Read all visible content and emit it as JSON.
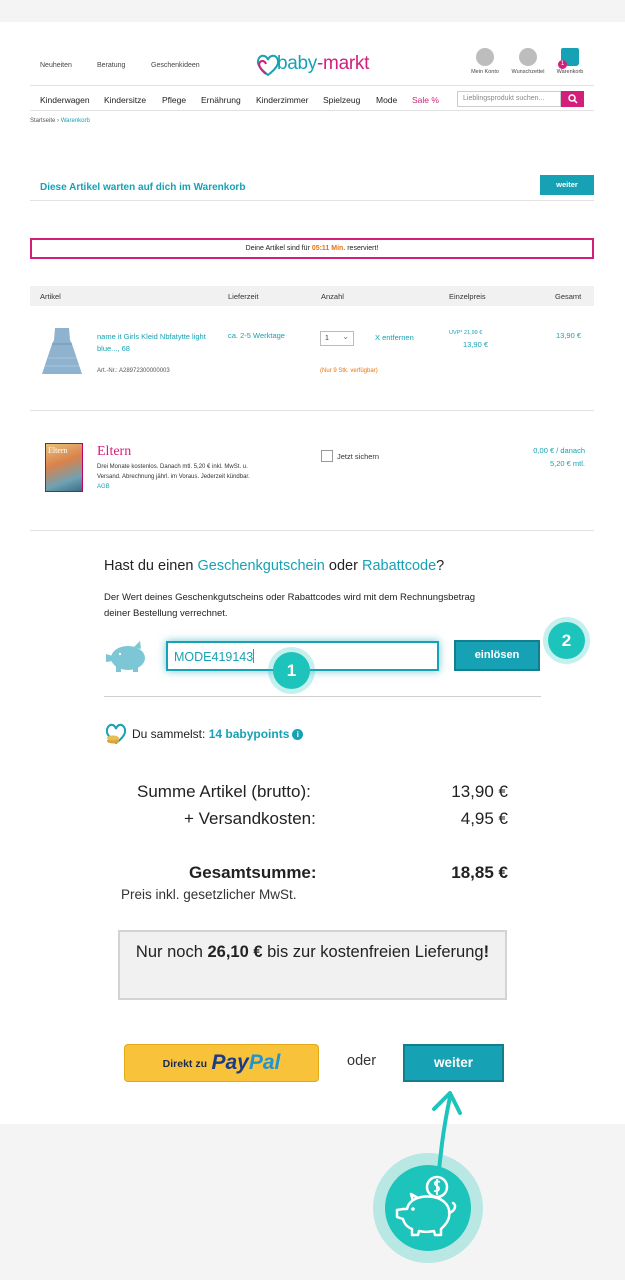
{
  "header": {
    "top_links": [
      "Neuheiten",
      "Beratung",
      "Geschenkideen"
    ],
    "logo": {
      "part1": "baby",
      "part2": "-markt"
    },
    "icons": [
      {
        "label": "Mein Konto",
        "icon": "user-icon"
      },
      {
        "label": "Wunschzettel",
        "icon": "heart-icon"
      },
      {
        "label": "Warenkorb",
        "icon": "shopping-bag-icon",
        "badge": "1"
      }
    ],
    "categories": [
      "Kinderwagen",
      "Kindersitze",
      "Pflege",
      "Ernährung",
      "Kinderzimmer",
      "Spielzeug",
      "Mode",
      "Sale %"
    ],
    "search_placeholder": "Lieblingsprodukt suchen..."
  },
  "breadcrumb": {
    "home": "Startseite",
    "sep": "›",
    "current": "Warenkorb"
  },
  "cart_header": {
    "title": "Diese Artikel warten auf dich im Warenkorb",
    "button": "weiter"
  },
  "reservation": {
    "before": "Deine Artikel sind für ",
    "time": "05:11 Min.",
    "after": " reserviert!"
  },
  "table": {
    "columns": [
      "Artikel",
      "Lieferzeit",
      "Anzahl",
      "Einzelpreis",
      "Gesamt"
    ]
  },
  "item": {
    "name": "name it Girls Kleid Nbfatytte light blue..., 68",
    "art_nr": "Art.-Nr.: A28972300000003",
    "delivery": "ca. 2-5 Werktage",
    "qty": "1",
    "remove": "X entfernen",
    "stock": "(Nur 9 Stk. verfügbar)",
    "uvp": "UVP*  21,99 €",
    "unit_price": "13,90 €",
    "total": "13,90 €"
  },
  "offer": {
    "cover_title": "Eltern",
    "title": "Eltern",
    "desc": "Drei Monate kostenlos. Danach mtl. 5,20 € inkl. MwSt. u. Versand. Abrechnung jährl. im Voraus. Jederzeit kündbar.",
    "agb": "AGB",
    "checkbox_label": "Jetzt sichern",
    "price_line1": "0,00 € / danach",
    "price_line2": "5,20 € mtl."
  },
  "voucher": {
    "q_prefix": "Hast du einen ",
    "q_term1": "Geschenkgutschein",
    "q_mid": " oder ",
    "q_term2": "Rabattcode",
    "q_suffix": "?",
    "desc": "Der Wert deines Geschenkgutscheins oder Rabattcodes wird mit dem Rechnungsbetrag deiner Bestellung verrechnet.",
    "code": "MODE419143",
    "button": "einlösen",
    "step1": "1",
    "step2": "2"
  },
  "points": {
    "prefix": "Du sammelst: ",
    "value": "14 babypoints",
    "info": "i"
  },
  "summary": {
    "subtotal_label": "Summe Artikel (brutto):",
    "subtotal": "13,90 €",
    "shipping_label": "+ Versandkosten:",
    "shipping": "4,95 €",
    "total_label": "Gesamtsumme:",
    "total": "18,85 €",
    "vat_note": "Preis inkl. gesetzlicher MwSt."
  },
  "free_shipping": {
    "prefix": "Nur noch ",
    "amount": "26,10 €",
    "suffix": " bis zur kostenfreien Lieferung",
    "end": "!"
  },
  "checkout": {
    "paypal_prefix": "Direkt zu",
    "paypal_pay": "Pay",
    "paypal_pal": "Pal",
    "or": "oder",
    "continue": "weiter"
  },
  "colors": {
    "accent": "#16a2b4",
    "brand_pink": "#d21f7b",
    "highlight": "#1dc4bc",
    "paypal": "#f8c23a"
  }
}
